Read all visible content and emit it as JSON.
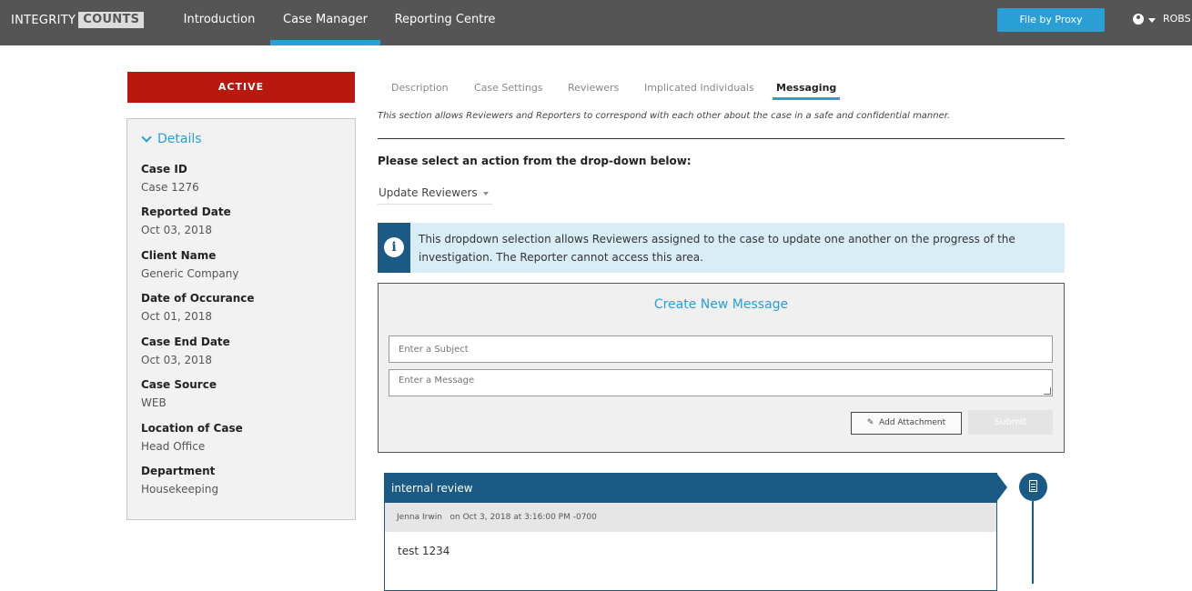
{
  "topbar": {
    "logo_part1": "INTEGRITY",
    "logo_part2": "COUNTS",
    "nav": [
      "Introduction",
      "Case Manager",
      "Reporting Centre"
    ],
    "active_nav": "Case Manager",
    "proxy_button": "File by Proxy",
    "user_name": "ROBS"
  },
  "case_status": "ACTIVE",
  "details": {
    "heading": "Details",
    "fields": [
      {
        "label": "Case ID",
        "value": "Case 1276"
      },
      {
        "label": "Reported Date",
        "value": "Oct 03, 2018"
      },
      {
        "label": "Client Name",
        "value": "Generic Company"
      },
      {
        "label": "Date of Occurance",
        "value": "Oct 01, 2018"
      },
      {
        "label": "Case End Date",
        "value": "Oct 03, 2018"
      },
      {
        "label": "Case Source",
        "value": "WEB"
      },
      {
        "label": "Location of Case",
        "value": "Head Office"
      },
      {
        "label": "Department",
        "value": "Housekeeping"
      }
    ]
  },
  "tabs": [
    "Description",
    "Case Settings",
    "Reviewers",
    "Implicated Individuals",
    "Messaging"
  ],
  "active_tab": "Messaging",
  "messaging": {
    "intro": "This section allows Reviewers and Reporters to correspond with each other about the case in a safe and confidential manner.",
    "prompt": "Please select an action from the drop-down below:",
    "dropdown_value": "Update Reviewers",
    "info_text": "This dropdown selection allows Reviewers assigned to the case to update one another on the progress of the investigation. The Reporter cannot access this area.",
    "create": {
      "title": "Create New Message",
      "subject_placeholder": "Enter a Subject",
      "message_placeholder": "Enter a Message",
      "attach_label": "Add Attachment",
      "submit_label": "Submit"
    },
    "thread": [
      {
        "subject": "internal review",
        "author": "Jenna Irwin",
        "timestamp": "on Oct 3, 2018 at 3:16:00 PM -0700",
        "body": "test 1234"
      }
    ]
  },
  "colors": {
    "topbar": "#555555",
    "accent": "#2a9fd6",
    "status_active": "#b8180d",
    "thread_header": "#1a5a85",
    "info_bg": "#d9edf7"
  }
}
